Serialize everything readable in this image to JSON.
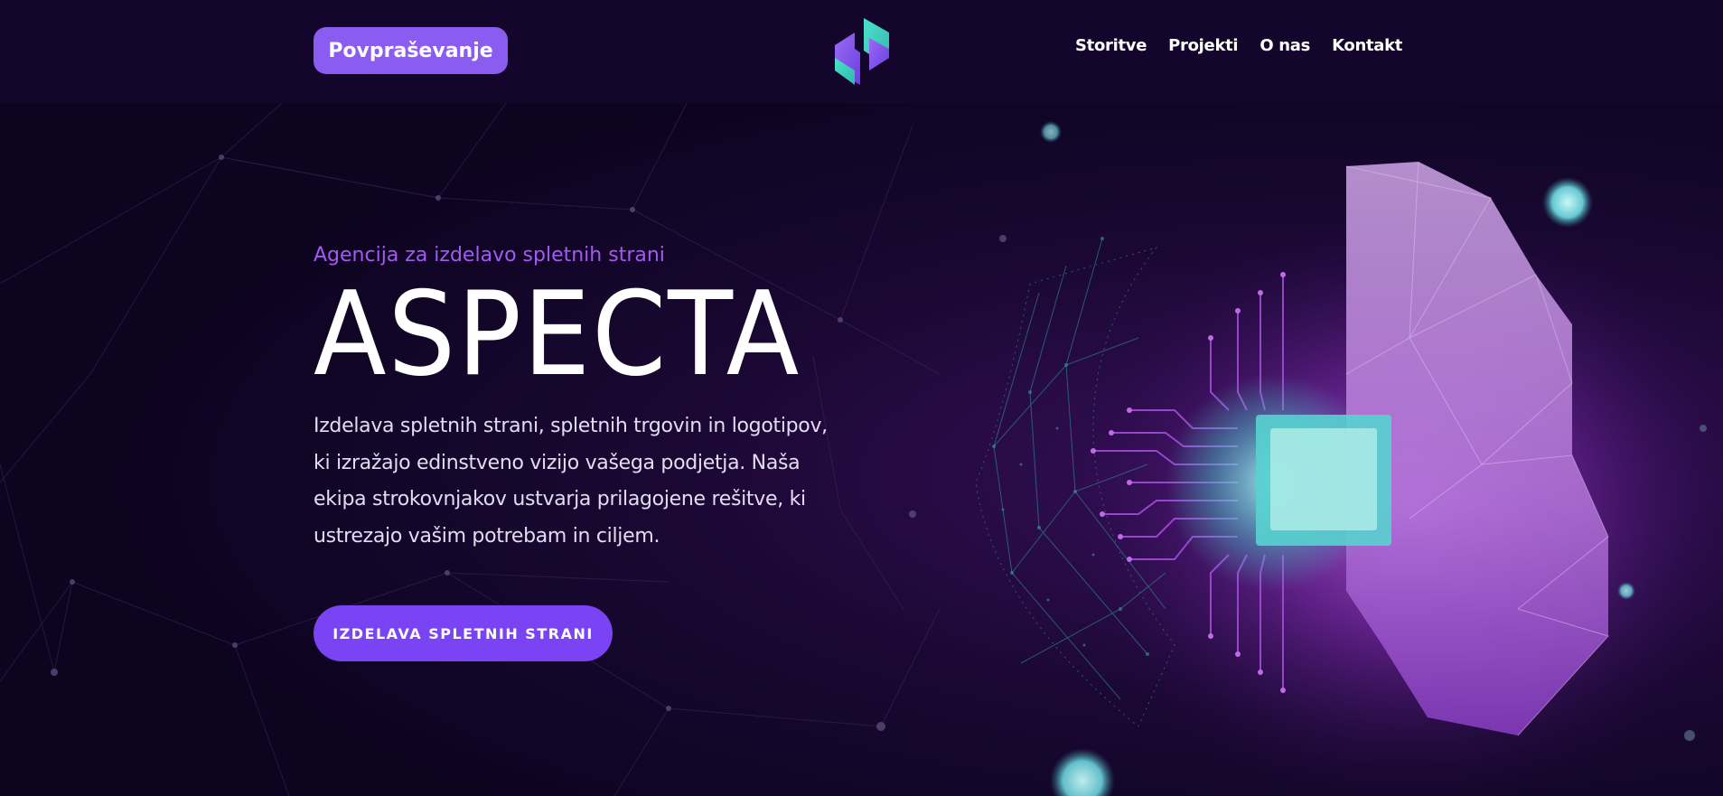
{
  "header": {
    "cta_label": "Povpraševanje",
    "nav": [
      {
        "label": "Storitve"
      },
      {
        "label": "Projekti"
      },
      {
        "label": "O nas"
      },
      {
        "label": "Kontakt"
      }
    ],
    "logo_icon": "aspecta-logo-icon"
  },
  "hero": {
    "subtitle": "Agencija za izdelavo spletnih strani",
    "title": "ASPECTA",
    "description": "Izdelava spletnih strani, spletnih trgovin in logotipov, ki izražajo edinstveno vizijo vašega podjetja. Naša ekipa strokovnjakov ustvarja prilagojene rešitve, ki ustrezajo vašim potrebam in ciljem.",
    "cta_label": "IZDELAVA SPLETNIH STRANI"
  },
  "colors": {
    "background": "#0d0420",
    "header_bg": "#13052b",
    "accent_purple": "#8a5cf0",
    "cta_purple": "#7a44f5",
    "subtitle_purple": "#a25bf0",
    "teal": "#3fd6c8"
  }
}
